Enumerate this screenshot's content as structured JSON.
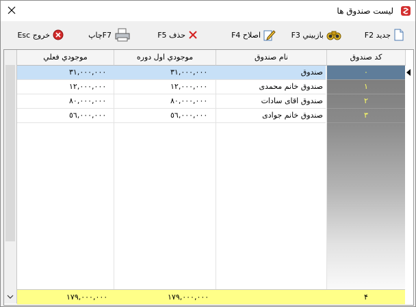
{
  "window": {
    "title": "ليست صندوق ها"
  },
  "toolbar": {
    "new_label": "جديد F2",
    "inspect_label": "بازبيني F3",
    "edit_label": "اصلاح F4",
    "delete_label": "حذف F5",
    "print_label": "F7چاپ",
    "exit_label": "خروج Esc"
  },
  "columns": {
    "code": "كد صندوق",
    "name": "نام صندوق",
    "opening": "موجودي اول دوره",
    "actual": "موجودي فعلي"
  },
  "rows": [
    {
      "code": "٠",
      "name": "صندوق",
      "opening": "٣١,٠٠٠,٠٠٠",
      "actual": "٣١,٠٠٠,٠٠٠",
      "selected": true
    },
    {
      "code": "١",
      "name": "صندوق خانم محمدی",
      "opening": "١٢,٠٠٠,٠٠٠",
      "actual": "١٢,٠٠٠,٠٠٠",
      "selected": false
    },
    {
      "code": "٢",
      "name": "صندوق اقای سادات",
      "opening": "٨٠,٠٠٠,٠٠٠",
      "actual": "٨٠,٠٠٠,٠٠٠",
      "selected": false
    },
    {
      "code": "٣",
      "name": "صندوق خانم جوادی",
      "opening": "٥٦,٠٠٠,٠٠٠",
      "actual": "٥٦,٠٠٠,٠٠٠",
      "selected": false
    }
  ],
  "totals": {
    "count": "۴",
    "opening": "١٧٩,٠٠٠,٠٠٠",
    "actual": "١٧٩,٠٠٠,٠٠٠"
  },
  "colors": {
    "code_text": "#ffff66",
    "selected_row": "#c7e0f7",
    "footer": "#ffff88"
  }
}
